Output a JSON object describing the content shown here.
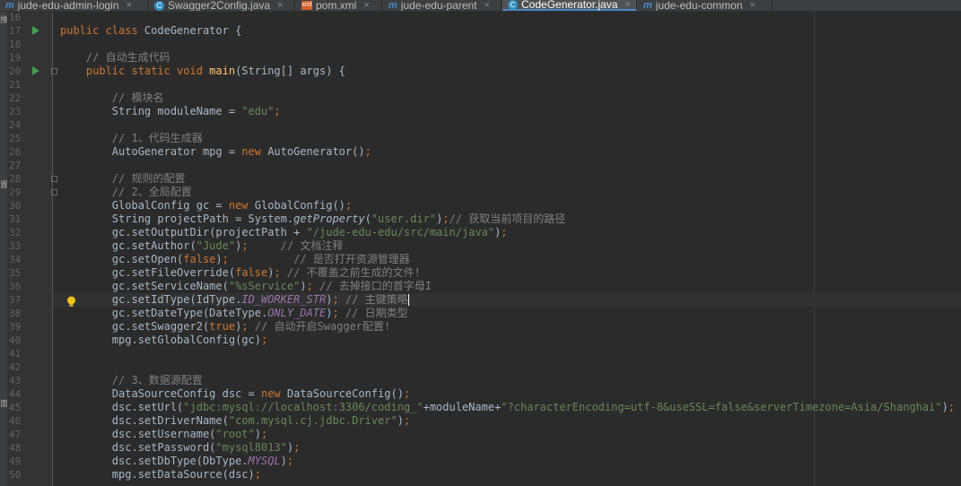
{
  "tabs": [
    {
      "label": "jude-edu-admin-login",
      "icon": "maven-module-icon",
      "active": false
    },
    {
      "label": "Swagger2Config.java",
      "icon": "java-class-icon",
      "active": false
    },
    {
      "label": "pom.xml",
      "icon": "maven-pom-icon",
      "active": false
    },
    {
      "label": "jude-edu-parent",
      "icon": "maven-module-icon",
      "active": false
    },
    {
      "label": "CodeGenerator.java",
      "icon": "java-class-icon",
      "active": true
    },
    {
      "label": "jude-edu-common",
      "icon": "maven-module-icon",
      "active": false
    }
  ],
  "side_panel_labels": [
    "推",
    "置",
    "面"
  ],
  "line_numbers": [
    "16",
    "17",
    "18",
    "19",
    "20",
    "21",
    "22",
    "23",
    "24",
    "25",
    "26",
    "27",
    "28",
    "29",
    "30",
    "31",
    "32",
    "33",
    "34",
    "35",
    "36",
    "37",
    "38",
    "39",
    "40",
    "41",
    "42",
    "43",
    "44",
    "45",
    "46",
    "47",
    "48",
    "49",
    "50"
  ],
  "current_line": "37",
  "code_lines": [
    [],
    [
      {
        "t": "public class ",
        "c": "kw"
      },
      {
        "t": "CodeGenerator {",
        "c": ""
      }
    ],
    [],
    [
      {
        "t": "    // 自动生成代码",
        "c": "cm"
      }
    ],
    [
      {
        "t": "    public static void ",
        "c": "kw"
      },
      {
        "t": "main",
        "c": "fn"
      },
      {
        "t": "(String[] args) {",
        "c": ""
      }
    ],
    [],
    [
      {
        "t": "        // 模块名",
        "c": "cm"
      }
    ],
    [
      {
        "t": "        String moduleName = ",
        "c": ""
      },
      {
        "t": "\"edu\"",
        "c": "st"
      },
      {
        "t": ";",
        "c": "kw"
      }
    ],
    [],
    [
      {
        "t": "        // 1、代码生成器",
        "c": "cm"
      }
    ],
    [
      {
        "t": "        AutoGenerator mpg = ",
        "c": ""
      },
      {
        "t": "new ",
        "c": "kw"
      },
      {
        "t": "AutoGenerator()",
        "c": ""
      },
      {
        "t": ";",
        "c": "kw"
      }
    ],
    [],
    [
      {
        "t": "        // 规则的配置",
        "c": "cm"
      }
    ],
    [
      {
        "t": "        // 2、全局配置",
        "c": "cm"
      }
    ],
    [
      {
        "t": "        GlobalConfig gc = ",
        "c": ""
      },
      {
        "t": "new ",
        "c": "kw"
      },
      {
        "t": "GlobalConfig()",
        "c": ""
      },
      {
        "t": ";",
        "c": "kw"
      }
    ],
    [
      {
        "t": "        String projectPath = System.",
        "c": ""
      },
      {
        "t": "getProperty",
        "c": "it"
      },
      {
        "t": "(",
        "c": ""
      },
      {
        "t": "\"user.dir\"",
        "c": "st"
      },
      {
        "t": ")",
        "c": ""
      },
      {
        "t": ";",
        "c": "kw"
      },
      {
        "t": "// 获取当前项目的路径",
        "c": "cm"
      }
    ],
    [
      {
        "t": "        gc.setOutputDir(projectPath + ",
        "c": ""
      },
      {
        "t": "\"/jude-edu-edu/src/main/java\"",
        "c": "st"
      },
      {
        "t": ")",
        "c": ""
      },
      {
        "t": ";",
        "c": "kw"
      }
    ],
    [
      {
        "t": "        gc.setAuthor(",
        "c": ""
      },
      {
        "t": "\"Jude\"",
        "c": "st"
      },
      {
        "t": ")",
        "c": ""
      },
      {
        "t": ";     ",
        "c": "kw"
      },
      {
        "t": "// 文档注释",
        "c": "cm"
      }
    ],
    [
      {
        "t": "        gc.setOpen(",
        "c": ""
      },
      {
        "t": "false",
        "c": "kw"
      },
      {
        "t": ")",
        "c": ""
      },
      {
        "t": ";          ",
        "c": "kw"
      },
      {
        "t": "// 是否打开资源管理器",
        "c": "cm"
      }
    ],
    [
      {
        "t": "        gc.setFileOverride(",
        "c": ""
      },
      {
        "t": "false",
        "c": "kw"
      },
      {
        "t": ")",
        "c": ""
      },
      {
        "t": "; ",
        "c": "kw"
      },
      {
        "t": "// 不覆盖之前生成的文件!",
        "c": "cm"
      }
    ],
    [
      {
        "t": "        gc.setServiceName(",
        "c": ""
      },
      {
        "t": "\"%sService\"",
        "c": "st"
      },
      {
        "t": ")",
        "c": ""
      },
      {
        "t": "; ",
        "c": "kw"
      },
      {
        "t": "// 去掉接口的首字母I",
        "c": "cm"
      }
    ],
    [
      {
        "t": "        gc.setIdType(IdType.",
        "c": ""
      },
      {
        "t": "ID_WORKER_STR",
        "c": "const"
      },
      {
        "t": ")",
        "c": ""
      },
      {
        "t": "; ",
        "c": "kw"
      },
      {
        "t": "// 主键策略",
        "c": "cm"
      },
      {
        "t": "",
        "c": "caret"
      }
    ],
    [
      {
        "t": "        gc.setDateType(DateType.",
        "c": ""
      },
      {
        "t": "ONLY_DATE",
        "c": "const"
      },
      {
        "t": ")",
        "c": ""
      },
      {
        "t": "; ",
        "c": "kw"
      },
      {
        "t": "// 日期类型",
        "c": "cm"
      }
    ],
    [
      {
        "t": "        gc.setSwagger2(",
        "c": ""
      },
      {
        "t": "true",
        "c": "kw"
      },
      {
        "t": ")",
        "c": ""
      },
      {
        "t": "; ",
        "c": "kw"
      },
      {
        "t": "// 自动开启Swagger配置!",
        "c": "cm"
      }
    ],
    [
      {
        "t": "        mpg.setGlobalConfig(gc)",
        "c": ""
      },
      {
        "t": ";",
        "c": "kw"
      }
    ],
    [],
    [],
    [
      {
        "t": "        // 3、数据源配置",
        "c": "cm"
      }
    ],
    [
      {
        "t": "        DataSourceConfig dsc = ",
        "c": ""
      },
      {
        "t": "new ",
        "c": "kw"
      },
      {
        "t": "DataSourceConfig()",
        "c": ""
      },
      {
        "t": ";",
        "c": "kw"
      }
    ],
    [
      {
        "t": "        dsc.setUrl(",
        "c": ""
      },
      {
        "t": "\"jdbc:mysql://localhost:3306/coding_\"",
        "c": "st"
      },
      {
        "t": "+moduleName+",
        "c": ""
      },
      {
        "t": "\"?characterEncoding=utf-8&useSSL=false&serverTimezone=Asia/Shanghai\"",
        "c": "st"
      },
      {
        "t": ")",
        "c": ""
      },
      {
        "t": ";",
        "c": "kw"
      }
    ],
    [
      {
        "t": "        dsc.setDriverName(",
        "c": ""
      },
      {
        "t": "\"com.mysql.cj.jdbc.Driver\"",
        "c": "st"
      },
      {
        "t": ")",
        "c": ""
      },
      {
        "t": ";",
        "c": "kw"
      }
    ],
    [
      {
        "t": "        dsc.setUsername(",
        "c": ""
      },
      {
        "t": "\"root\"",
        "c": "st"
      },
      {
        "t": ")",
        "c": ""
      },
      {
        "t": ";",
        "c": "kw"
      }
    ],
    [
      {
        "t": "        dsc.setPassword(",
        "c": ""
      },
      {
        "t": "\"mysql8013\"",
        "c": "st"
      },
      {
        "t": ")",
        "c": ""
      },
      {
        "t": ";",
        "c": "kw"
      }
    ],
    [
      {
        "t": "        dsc.setDbType(DbType.",
        "c": ""
      },
      {
        "t": "MYSQL",
        "c": "const"
      },
      {
        "t": ")",
        "c": ""
      },
      {
        "t": ";",
        "c": "kw"
      }
    ],
    [
      {
        "t": "        mpg.setDataSource(dsc)",
        "c": ""
      },
      {
        "t": ";",
        "c": "kw"
      }
    ]
  ],
  "run_markers": [
    "17",
    "20"
  ],
  "fold_markers": [
    "20",
    "28",
    "29"
  ],
  "intention_bulb_line": "37",
  "colors": {
    "background": "#2b2b2b",
    "keyword": "#cc7832",
    "string": "#6a8759",
    "comment": "#808080",
    "method": "#ffc66d",
    "constant": "#9876aa"
  }
}
